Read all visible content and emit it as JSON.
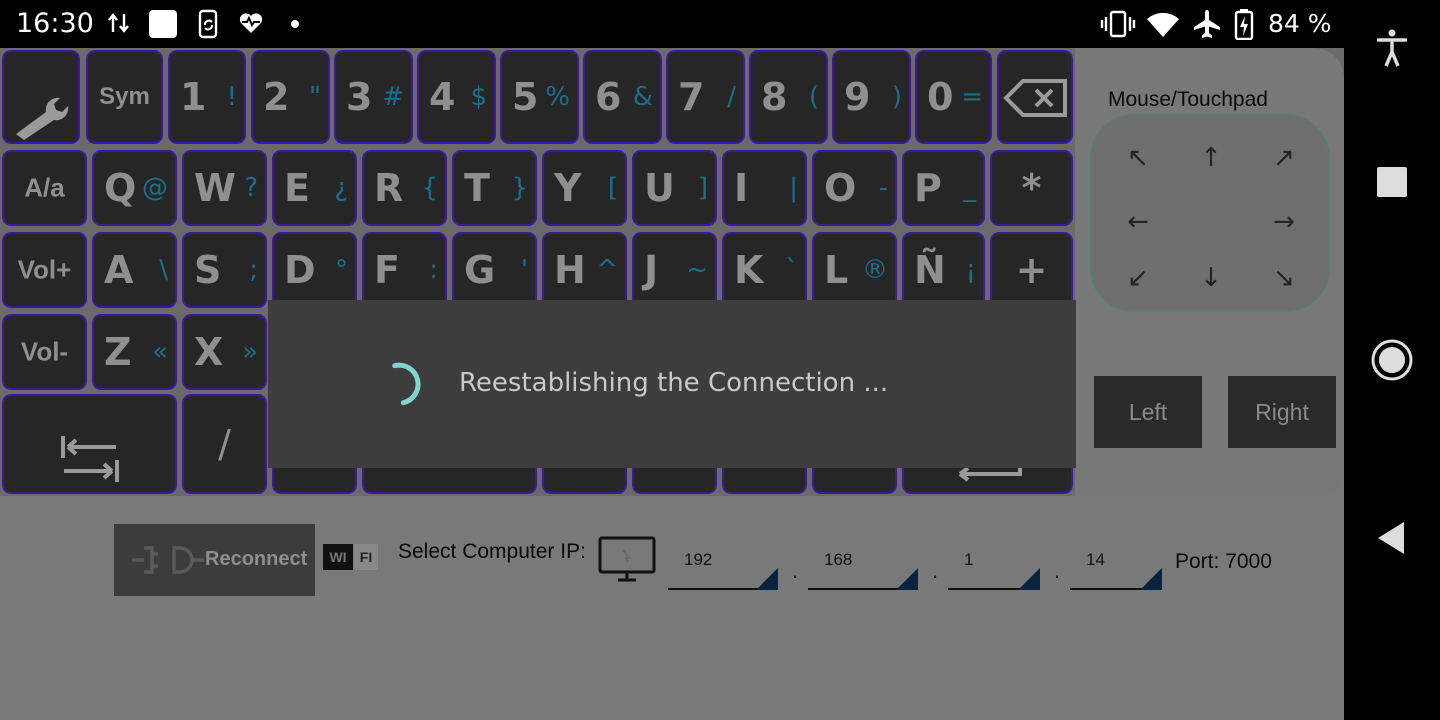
{
  "status_bar": {
    "time": "16:30",
    "battery_percent": "84 %",
    "icons": [
      "data-transfer-icon",
      "square-notification-icon",
      "phone-sync-icon",
      "heart-pulse-icon",
      "dot-icon",
      "vibrate-icon",
      "wifi-icon",
      "airplane-icon",
      "battery-icon"
    ]
  },
  "keyboard": {
    "rows": [
      [
        {
          "main": "",
          "sub": "",
          "icon": "wrench-icon"
        },
        {
          "main": "Sym",
          "sub": ""
        },
        {
          "main": "1",
          "sub": "!"
        },
        {
          "main": "2",
          "sub": "\""
        },
        {
          "main": "3",
          "sub": "#"
        },
        {
          "main": "4",
          "sub": "$"
        },
        {
          "main": "5",
          "sub": "%"
        },
        {
          "main": "6",
          "sub": "&"
        },
        {
          "main": "7",
          "sub": "/"
        },
        {
          "main": "8",
          "sub": "("
        },
        {
          "main": "9",
          "sub": ")"
        },
        {
          "main": "0",
          "sub": "="
        },
        {
          "main": "",
          "sub": "",
          "icon": "backspace-icon"
        }
      ],
      [
        {
          "main": "A/a",
          "sub": ""
        },
        {
          "main": "Q",
          "sub": "@"
        },
        {
          "main": "W",
          "sub": "?"
        },
        {
          "main": "E",
          "sub": "¿"
        },
        {
          "main": "R",
          "sub": "{"
        },
        {
          "main": "T",
          "sub": "}"
        },
        {
          "main": "Y",
          "sub": "["
        },
        {
          "main": "U",
          "sub": "]"
        },
        {
          "main": "I",
          "sub": "|"
        },
        {
          "main": "O",
          "sub": "-"
        },
        {
          "main": "P",
          "sub": "_"
        },
        {
          "main": "*",
          "sub": ""
        }
      ],
      [
        {
          "main": "Vol+",
          "sub": ""
        },
        {
          "main": "A",
          "sub": "\\"
        },
        {
          "main": "S",
          "sub": ";"
        },
        {
          "main": "D",
          "sub": "°"
        },
        {
          "main": "F",
          "sub": ":"
        },
        {
          "main": "G",
          "sub": "'"
        },
        {
          "main": "H",
          "sub": "^"
        },
        {
          "main": "J",
          "sub": "~"
        },
        {
          "main": "K",
          "sub": "`"
        },
        {
          "main": "L",
          "sub": "®"
        },
        {
          "main": "Ñ",
          "sub": "¡"
        },
        {
          "main": "+",
          "sub": ""
        }
      ],
      [
        {
          "main": "Vol-",
          "sub": ""
        },
        {
          "main": "Z",
          "sub": "«"
        },
        {
          "main": "X",
          "sub": "»"
        }
      ],
      [
        {
          "main": "",
          "sub": "",
          "icon": "tab-icon"
        },
        {
          "main": "/",
          "sub": ""
        }
      ]
    ]
  },
  "mouse": {
    "title": "Mouse/Touchpad",
    "arrows": [
      "↖",
      "↑",
      "↗",
      "←",
      "→",
      "↙",
      "↓",
      "↘"
    ],
    "left_label": "Left",
    "right_label": "Right"
  },
  "dialog": {
    "message": "Reestablishing the Connection ..."
  },
  "connection": {
    "reconnect_label": "Reconnect",
    "wifi_badge_a": "WI",
    "wifi_badge_b": "FI",
    "select_ip_label": "Select Computer IP:",
    "ip": [
      "192",
      "168",
      "1",
      "14"
    ],
    "port_label": "Port: 7000"
  },
  "colors": {
    "key_bg": "#262626",
    "key_border": "#3b1aa0",
    "sub_char": "#1c6f8c",
    "spinner": "#7fd6cc"
  }
}
